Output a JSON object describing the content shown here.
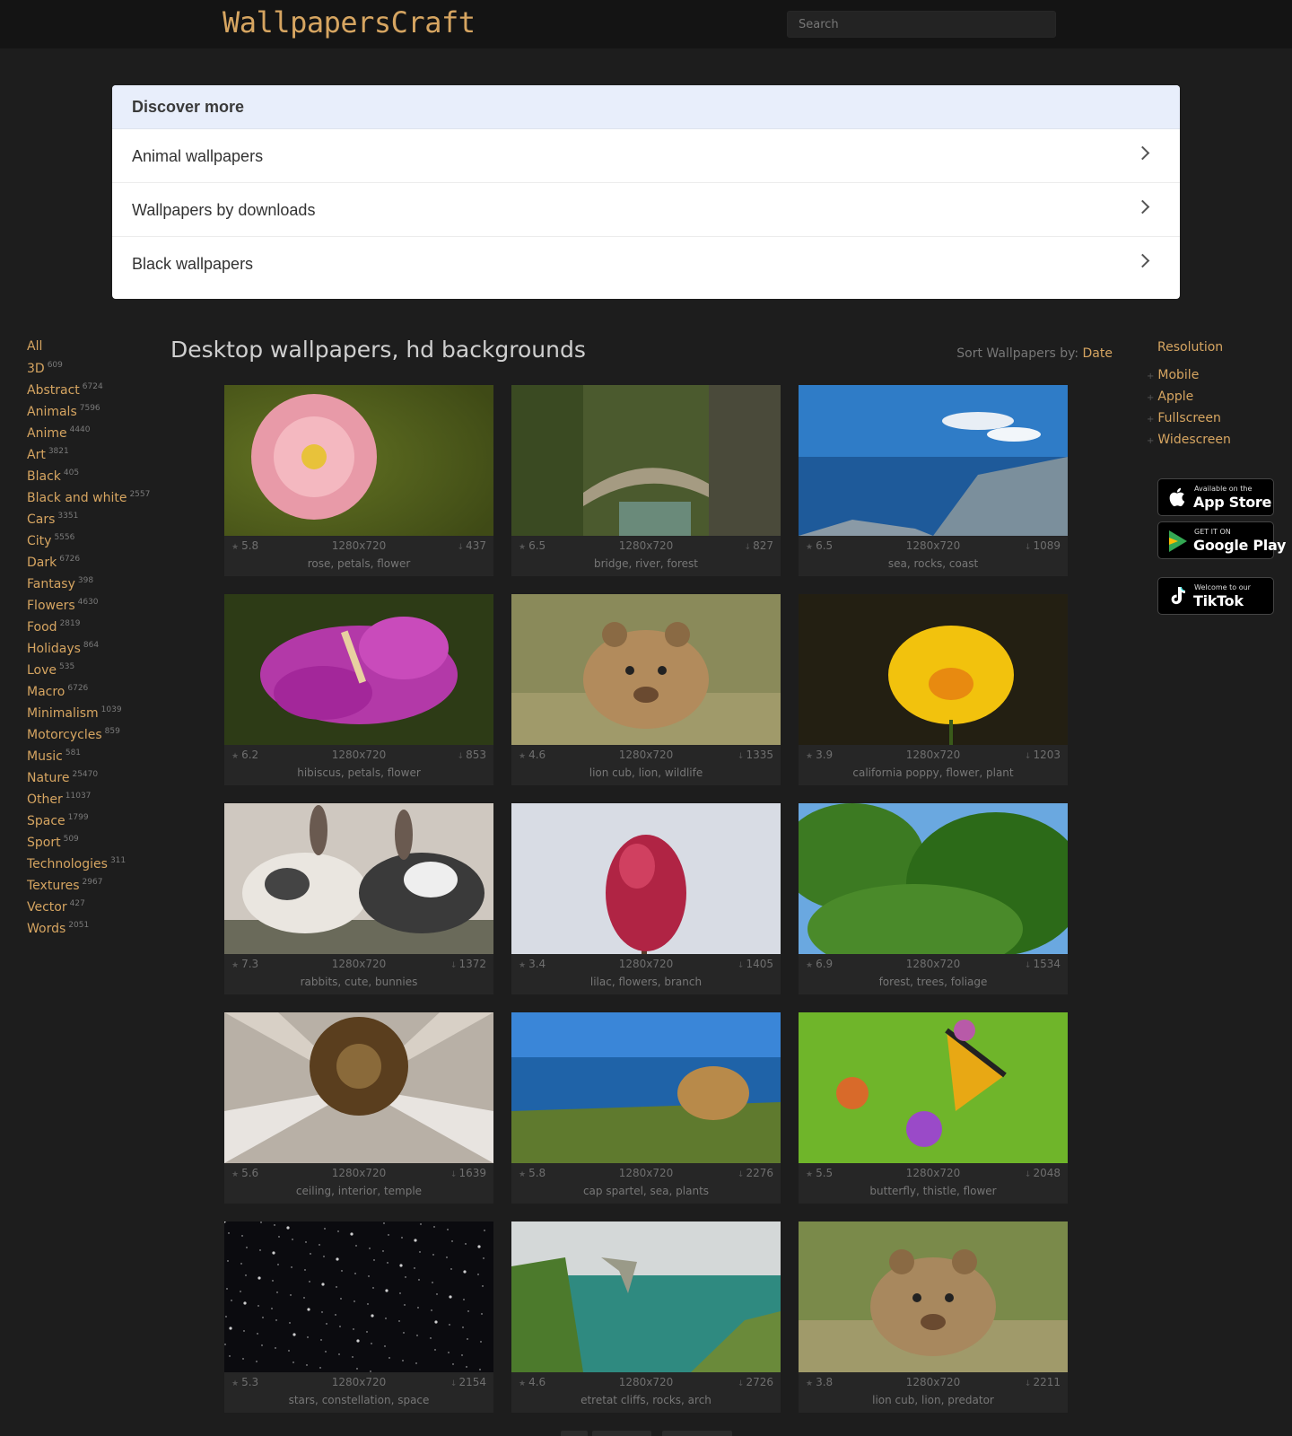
{
  "header": {
    "logo": "WallpapersCraft",
    "search_placeholder": "Search"
  },
  "discover": {
    "title": "Discover more",
    "items": [
      {
        "label": "Animal wallpapers"
      },
      {
        "label": "Wallpapers by downloads"
      },
      {
        "label": "Black wallpapers"
      }
    ]
  },
  "categories": {
    "all_label": "All",
    "items": [
      {
        "label": "3D",
        "count": "609"
      },
      {
        "label": "Abstract",
        "count": "6724"
      },
      {
        "label": "Animals",
        "count": "7596"
      },
      {
        "label": "Anime",
        "count": "4440"
      },
      {
        "label": "Art",
        "count": "3821"
      },
      {
        "label": "Black",
        "count": "405"
      },
      {
        "label": "Black and white",
        "count": "2557"
      },
      {
        "label": "Cars",
        "count": "3351"
      },
      {
        "label": "City",
        "count": "5556"
      },
      {
        "label": "Dark",
        "count": "6726"
      },
      {
        "label": "Fantasy",
        "count": "398"
      },
      {
        "label": "Flowers",
        "count": "4630"
      },
      {
        "label": "Food",
        "count": "2819"
      },
      {
        "label": "Holidays",
        "count": "864"
      },
      {
        "label": "Love",
        "count": "535"
      },
      {
        "label": "Macro",
        "count": "6726"
      },
      {
        "label": "Minimalism",
        "count": "1039"
      },
      {
        "label": "Motorcycles",
        "count": "859"
      },
      {
        "label": "Music",
        "count": "581"
      },
      {
        "label": "Nature",
        "count": "25470"
      },
      {
        "label": "Other",
        "count": "11037"
      },
      {
        "label": "Space",
        "count": "1799"
      },
      {
        "label": "Sport",
        "count": "509"
      },
      {
        "label": "Technologies",
        "count": "311"
      },
      {
        "label": "Textures",
        "count": "2967"
      },
      {
        "label": "Vector",
        "count": "427"
      },
      {
        "label": "Words",
        "count": "2051"
      }
    ]
  },
  "main": {
    "title": "Desktop wallpapers, hd backgrounds",
    "sort_label": "Sort Wallpapers by:",
    "sort_value": "Date"
  },
  "resolution": {
    "title": "Resolution",
    "items": [
      {
        "label": "Mobile"
      },
      {
        "label": "Apple"
      },
      {
        "label": "Fullscreen"
      },
      {
        "label": "Widescreen"
      }
    ]
  },
  "stores": {
    "appstore": {
      "small": "Available on the",
      "big": "App Store"
    },
    "googleplay": {
      "small": "GET IT ON",
      "big": "Google Play"
    },
    "tiktok": {
      "small": "Welcome to our",
      "big": "TikTok"
    }
  },
  "wallpapers": [
    {
      "rating": "5.8",
      "resolution": "1280x720",
      "downloads": "437",
      "tags": "rose, petals, flower",
      "theme": "rose",
      "colors": [
        "#e89aa8",
        "#5a6a1f"
      ]
    },
    {
      "rating": "6.5",
      "resolution": "1280x720",
      "downloads": "827",
      "tags": "bridge, river, forest",
      "theme": "bridge",
      "colors": [
        "#4b5a2e",
        "#a59b82"
      ]
    },
    {
      "rating": "6.5",
      "resolution": "1280x720",
      "downloads": "1089",
      "tags": "sea, rocks, coast",
      "theme": "sea",
      "colors": [
        "#2f7cc7",
        "#7b8f9c"
      ]
    },
    {
      "rating": "6.2",
      "resolution": "1280x720",
      "downloads": "853",
      "tags": "hibiscus, petals, flower",
      "theme": "hibiscus",
      "colors": [
        "#b339a8",
        "#2d3b16"
      ]
    },
    {
      "rating": "4.6",
      "resolution": "1280x720",
      "downloads": "1335",
      "tags": "lion cub, lion, wildlife",
      "theme": "cub",
      "colors": [
        "#b28b5c",
        "#8a8a5a"
      ]
    },
    {
      "rating": "3.9",
      "resolution": "1280x720",
      "downloads": "1203",
      "tags": "california poppy, flower, plant",
      "theme": "poppy",
      "colors": [
        "#f2c20d",
        "#1d1a10"
      ]
    },
    {
      "rating": "7.3",
      "resolution": "1280x720",
      "downloads": "1372",
      "tags": "rabbits, cute, bunnies",
      "theme": "rabbits",
      "colors": [
        "#eae6e0",
        "#3a3a3a"
      ]
    },
    {
      "rating": "3.4",
      "resolution": "1280x720",
      "downloads": "1405",
      "tags": "lilac, flowers, branch",
      "theme": "lilac",
      "colors": [
        "#d8dce4",
        "#b02444"
      ]
    },
    {
      "rating": "6.9",
      "resolution": "1280x720",
      "downloads": "1534",
      "tags": "forest, trees, foliage",
      "theme": "forest",
      "colors": [
        "#3c7a22",
        "#6aa8e0"
      ]
    },
    {
      "rating": "5.6",
      "resolution": "1280x720",
      "downloads": "1639",
      "tags": "ceiling, interior, temple",
      "theme": "ceiling",
      "colors": [
        "#5a3e1e",
        "#b8b0a6"
      ]
    },
    {
      "rating": "5.8",
      "resolution": "1280x720",
      "downloads": "2276",
      "tags": "cap spartel, sea, plants",
      "theme": "cap",
      "colors": [
        "#1f63a8",
        "#5f7a2e"
      ]
    },
    {
      "rating": "5.5",
      "resolution": "1280x720",
      "downloads": "2048",
      "tags": "butterfly, thistle, flower",
      "theme": "butterfly",
      "colors": [
        "#6fb52a",
        "#e8a814"
      ]
    },
    {
      "rating": "5.3",
      "resolution": "1280x720",
      "downloads": "2154",
      "tags": "stars, constellation, space",
      "theme": "stars",
      "colors": [
        "#0b0b0f",
        "#3a2f2a"
      ]
    },
    {
      "rating": "4.6",
      "resolution": "1280x720",
      "downloads": "2726",
      "tags": "etretat cliffs, rocks, arch",
      "theme": "cliffs",
      "colors": [
        "#2f8a80",
        "#4c7a2c"
      ]
    },
    {
      "rating": "3.8",
      "resolution": "1280x720",
      "downloads": "2211",
      "tags": "lion cub, lion, predator",
      "theme": "cub2",
      "colors": [
        "#a8885e",
        "#7a8a4a"
      ]
    }
  ]
}
